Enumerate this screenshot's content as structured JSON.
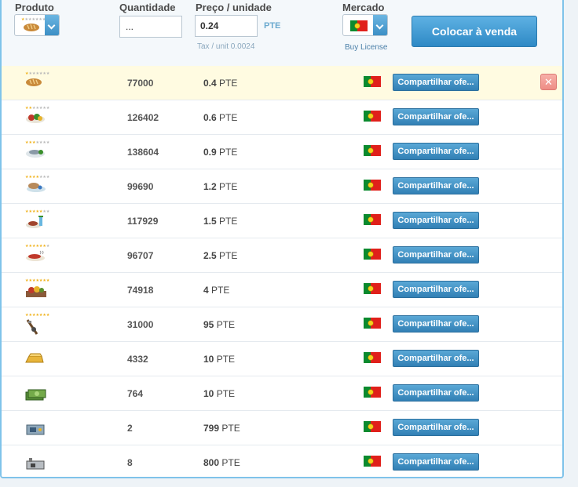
{
  "header": {
    "produto_label": "Produto",
    "quantidade_label": "Quantidade",
    "preco_label": "Preço / unidade",
    "mercado_label": "Mercado",
    "quantity_value": "...",
    "price_value": "0.24",
    "currency": "PTE",
    "tax_text": "Tax / unit 0.0024",
    "buy_license": "Buy License",
    "sell_button": "Colocar à venda",
    "selected_product_icon": "bread-icon",
    "selected_market_icon": "portugal-flag-icon"
  },
  "rows": [
    {
      "qty": "77000",
      "price_num": "0.4",
      "currency": "PTE",
      "stars": 1,
      "icon": "bread-icon",
      "share_label": "Compartilhar ofe...",
      "highlight": true
    },
    {
      "qty": "126402",
      "price_num": "0.6",
      "currency": "PTE",
      "stars": 2,
      "icon": "salad-icon",
      "share_label": "Compartilhar ofe..."
    },
    {
      "qty": "138604",
      "price_num": "0.9",
      "currency": "PTE",
      "stars": 3,
      "icon": "fish-plate-icon",
      "share_label": "Compartilhar ofe..."
    },
    {
      "qty": "99690",
      "price_num": "1.2",
      "currency": "PTE",
      "stars": 4,
      "icon": "chicken-plate-icon",
      "share_label": "Compartilhar ofe..."
    },
    {
      "qty": "117929",
      "price_num": "1.5",
      "currency": "PTE",
      "stars": 5,
      "icon": "meal-drink-icon",
      "share_label": "Compartilhar ofe..."
    },
    {
      "qty": "96707",
      "price_num": "2.5",
      "currency": "PTE",
      "stars": 6,
      "icon": "steak-icon",
      "share_label": "Compartilhar ofe..."
    },
    {
      "qty": "74918",
      "price_num": "4",
      "currency": "PTE",
      "stars": 7,
      "icon": "feast-icon",
      "share_label": "Compartilhar ofe..."
    },
    {
      "qty": "31000",
      "price_num": "95",
      "currency": "PTE",
      "stars": 7,
      "icon": "weapon-icon",
      "share_label": "Compartilhar ofe..."
    },
    {
      "qty": "4332",
      "price_num": "10",
      "currency": "PTE",
      "stars": 0,
      "icon": "gold-bar-icon",
      "share_label": "Compartilhar ofe..."
    },
    {
      "qty": "764",
      "price_num": "10",
      "currency": "PTE",
      "stars": 0,
      "icon": "money-stack-icon",
      "share_label": "Compartilhar ofe..."
    },
    {
      "qty": "2",
      "price_num": "799",
      "currency": "PTE",
      "stars": 0,
      "icon": "machine-icon",
      "share_label": "Compartilhar ofe..."
    },
    {
      "qty": "8",
      "price_num": "800",
      "currency": "PTE",
      "stars": 0,
      "icon": "factory-icon",
      "share_label": "Compartilhar ofe..."
    }
  ],
  "close_label": "✕",
  "colors": {
    "accent": "#3b8fc7",
    "highlight_row": "#fffbe1",
    "close": "#ee8d85"
  }
}
